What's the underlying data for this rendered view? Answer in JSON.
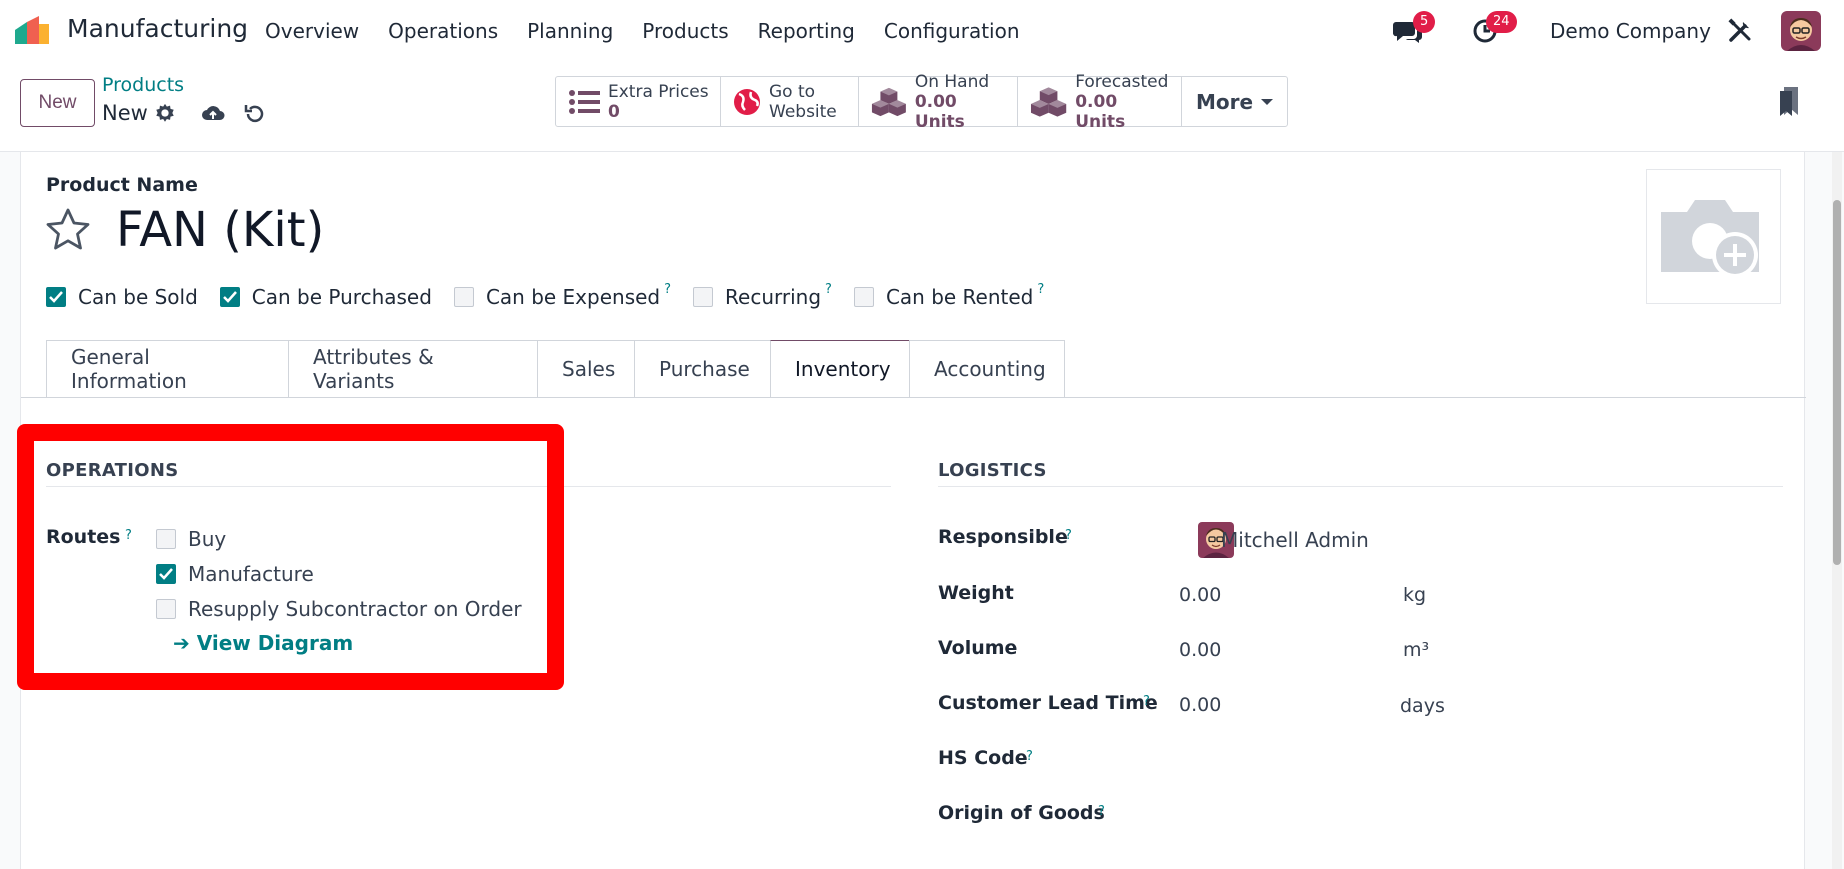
{
  "navbar": {
    "app_name": "Manufacturing",
    "menu": [
      "Overview",
      "Operations",
      "Planning",
      "Products",
      "Reporting",
      "Configuration"
    ],
    "messages_count": "5",
    "activities_count": "24",
    "company": "Demo Company"
  },
  "control_panel": {
    "new_label": "New",
    "breadcrumb_parent": "Products",
    "breadcrumb_current": "New",
    "smart_buttons": {
      "extra_prices": {
        "label": "Extra Prices",
        "value": "0"
      },
      "website": {
        "line1": "Go to",
        "line2": "Website"
      },
      "on_hand": {
        "label": "On Hand",
        "value": "0.00 Units"
      },
      "forecasted": {
        "label": "Forecasted",
        "value": "0.00 Units"
      },
      "more": "More"
    }
  },
  "form": {
    "product_name_label": "Product Name",
    "product_name": "FAN (Kit)",
    "checkboxes": [
      {
        "label": "Can be Sold",
        "checked": true,
        "help": ""
      },
      {
        "label": "Can be Purchased",
        "checked": true,
        "help": ""
      },
      {
        "label": "Can be Expensed",
        "checked": false,
        "help": "?"
      },
      {
        "label": "Recurring",
        "checked": false,
        "help": "?"
      },
      {
        "label": "Can be Rented",
        "checked": false,
        "help": "?"
      }
    ],
    "tabs": [
      "General Information",
      "Attributes & Variants",
      "Sales",
      "Purchase",
      "Inventory",
      "Accounting"
    ],
    "active_tab": "Inventory",
    "operations": {
      "title": "OPERATIONS",
      "routes_label": "Routes",
      "help": "?",
      "routes": [
        {
          "label": "Buy",
          "checked": false
        },
        {
          "label": "Manufacture",
          "checked": true
        },
        {
          "label": "Resupply Subcontractor on Order",
          "checked": false
        }
      ],
      "view_diagram": "➔ View Diagram"
    },
    "logistics": {
      "title": "LOGISTICS",
      "responsible_label": "Responsible",
      "responsible_value": "Mitchell Admin",
      "weight_label": "Weight",
      "weight_value": "0.00",
      "weight_unit": "kg",
      "volume_label": "Volume",
      "volume_value": "0.00",
      "volume_unit": "m³",
      "lead_time_label": "Customer Lead Time",
      "lead_time_value": "0.00",
      "lead_time_unit": "days",
      "hs_code_label": "HS Code",
      "origin_label": "Origin of Goods",
      "help": "?"
    }
  },
  "colors": {
    "brand": "#714b67",
    "accent": "#017e84",
    "highlight": "#ff0000",
    "badge": "#e11d48"
  }
}
